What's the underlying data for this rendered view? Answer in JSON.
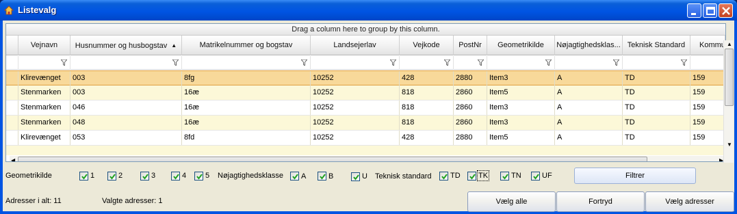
{
  "window": {
    "title": "Listevalg"
  },
  "grid": {
    "group_hint": "Drag a column here to group by this column.",
    "columns": [
      "Vejnavn",
      "Husnummer og husbogstav",
      "Matrikelnummer og bogstav",
      "Landsejerlav",
      "Vejkode",
      "PostNr",
      "Geometrikilde",
      "Nøjagtighedsklas...",
      "Teknisk Standard",
      "Kommu"
    ],
    "sort_indicator": "▲",
    "rows": [
      [
        "Klirevænget",
        "003",
        "8fg",
        "10252",
        "428",
        "2880",
        "Item3",
        "A",
        "TD",
        "159"
      ],
      [
        "Stenmarken",
        "003",
        "16æ",
        "10252",
        "818",
        "2860",
        "Item5",
        "A",
        "TD",
        "159"
      ],
      [
        "Stenmarken",
        "046",
        "16æ",
        "10252",
        "818",
        "2860",
        "Item3",
        "A",
        "TD",
        "159"
      ],
      [
        "Stenmarken",
        "048",
        "16æ",
        "10252",
        "818",
        "2860",
        "Item3",
        "A",
        "TD",
        "159"
      ],
      [
        "Klirevænget",
        "053",
        "8fd",
        "10252",
        "428",
        "2880",
        "Item5",
        "A",
        "TD",
        "159"
      ]
    ]
  },
  "filters": {
    "geometri_label": "Geometrikilde",
    "geometri_options": [
      "1",
      "2",
      "3",
      "4",
      "5"
    ],
    "noejagtighed_label": "Nøjagtighedsklasse",
    "noejagtighed_options": [
      "A",
      "B",
      "U"
    ],
    "teknisk_label": "Teknisk standard",
    "teknisk_options": [
      "TD",
      "TK",
      "TN",
      "UF"
    ],
    "filter_button": "Filtrer"
  },
  "status": {
    "total_label": "Adresser i alt: 11",
    "selected_label": "Valgte adresser: 1"
  },
  "buttons": {
    "select_all": "Vælg alle",
    "undo": "Fortryd",
    "choose": "Vælg adresser"
  }
}
